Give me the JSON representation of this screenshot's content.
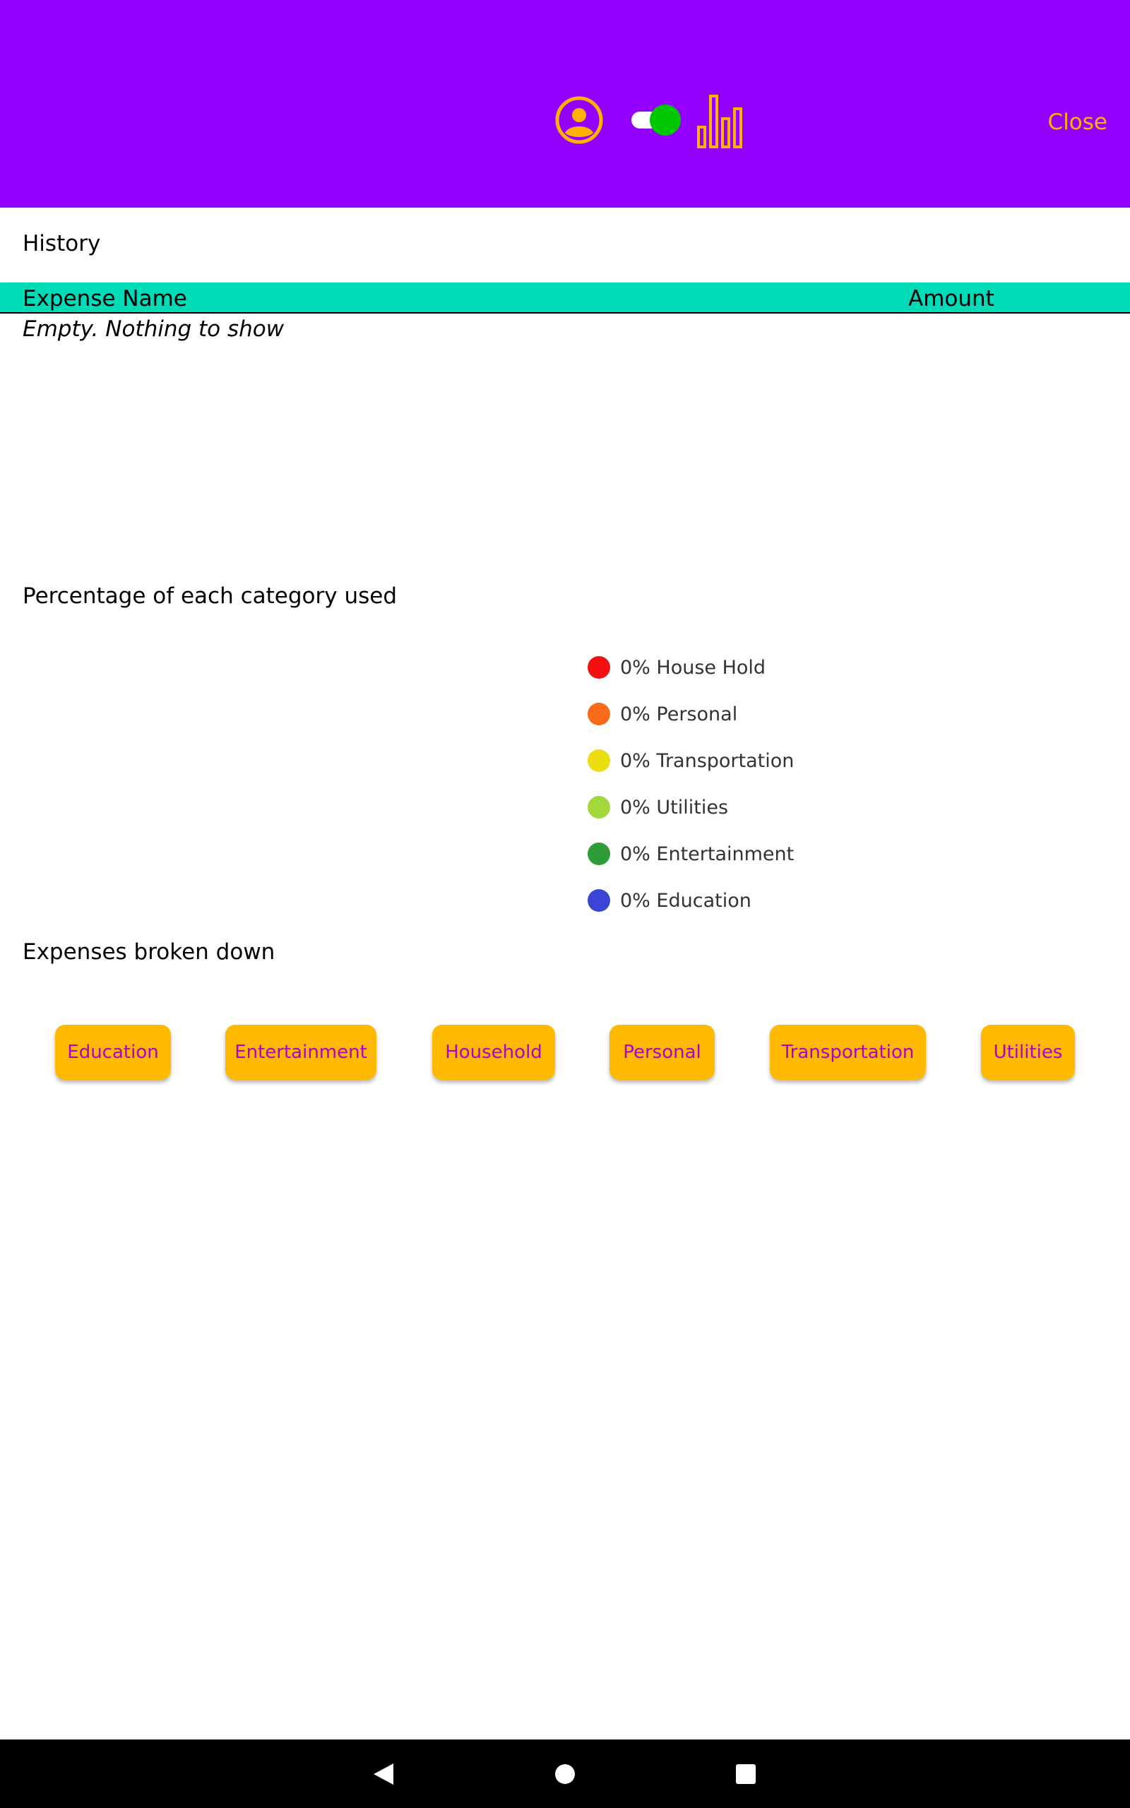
{
  "header": {
    "icons": [
      "account-circle-icon",
      "toggle-switch-icon",
      "bar-chart-icon"
    ],
    "close_label": "Close",
    "colors": {
      "background": "#9400ff",
      "accent": "#ffb300",
      "toggle_knob": "#00c800"
    }
  },
  "history": {
    "title": "History",
    "columns": [
      "Expense Name",
      "Amount"
    ],
    "empty_message": "Empty. Nothing to show",
    "header_color": "#00dcb8"
  },
  "percentage": {
    "title": "Percentage of each category used",
    "legend": [
      {
        "label": "0% House Hold",
        "color": "#f40f10"
      },
      {
        "label": "0% Personal",
        "color": "#f76b1b"
      },
      {
        "label": "0% Transportation",
        "color": "#ecdd10"
      },
      {
        "label": "0% Utilities",
        "color": "#a2d83c"
      },
      {
        "label": "0% Entertainment",
        "color": "#2d9b36"
      },
      {
        "label": "0% Education",
        "color": "#3a45d6"
      }
    ]
  },
  "breakdown": {
    "title": "Expenses broken down",
    "buttons": [
      "Education",
      "Entertainment",
      "Household",
      "Personal",
      "Transportation",
      "Utilities"
    ]
  },
  "navbar": {
    "icons": [
      "back-icon",
      "home-icon",
      "recents-icon"
    ]
  }
}
